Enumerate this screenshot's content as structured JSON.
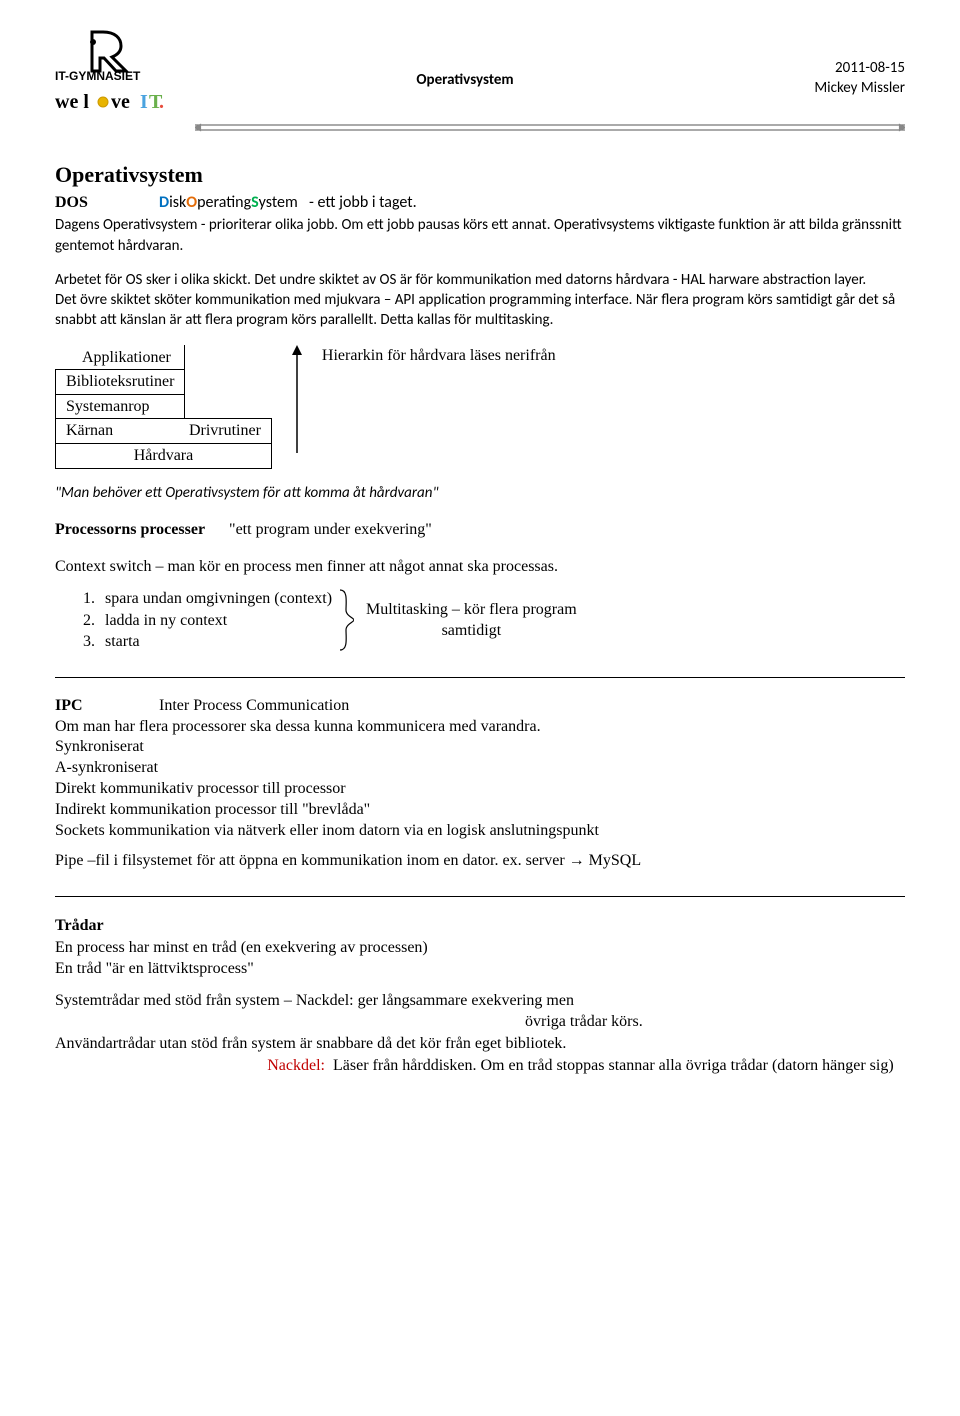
{
  "header": {
    "logo_alt": "IT-GYMNASIET — we love IT.",
    "center_title": "Operativsystem",
    "date": "2011-08-15",
    "author": "Mickey Missler"
  },
  "h1": "Operativsystem",
  "dos": {
    "term": "DOS",
    "expansion_pre_d": "D",
    "expansion_mid1": "isk",
    "expansion_pre_o": "O",
    "expansion_mid2": "perating",
    "expansion_pre_s": "S",
    "expansion_mid3": "ystem",
    "tail": "- ett jobb i taget."
  },
  "intro": {
    "p1": "Dagens Operativsystem - prioriterar olika jobb. Om ett jobb pausas körs ett annat. Operativsystems viktigaste funktion är att bilda gränssnitt gentemot hårdvaran.",
    "p2": "Arbetet för OS sker i olika skickt. Det undre skiktet av OS är för kommunikation med datorns hårdvara - HAL harware abstraction layer.",
    "p3": "Det övre skiktet sköter kommunikation med mjukvara – API application programming interface. När flera program körs samtidigt går det så snabbt att känslan är att flera program körs parallellt. Detta kallas för multitasking."
  },
  "hier": {
    "rows": [
      [
        "Applikationer"
      ],
      [
        "Biblioteksrutiner"
      ],
      [
        "Systemanrop"
      ],
      [
        "Kärnan",
        "Drivrutiner"
      ],
      [
        "Hårdvara"
      ]
    ],
    "caption": "Hierarkin för hårdvara läses nerifrån"
  },
  "quote": "\"Man behöver ett Operativsystem för att komma åt hårdvaran\"",
  "proc": {
    "heading": "Processorns processer",
    "sub": "\"ett program under exekvering\"",
    "context_switch": "Context switch – man kör en process men finner att något annat ska processas.",
    "list": [
      {
        "n": "1.",
        "t": "spara undan omgivningen (context)"
      },
      {
        "n": "2.",
        "t": "ladda in ny context"
      },
      {
        "n": "3.",
        "t": "starta"
      }
    ],
    "multitask_l1": "Multitasking – kör flera program",
    "multitask_l2": "samtidigt"
  },
  "ipc": {
    "term": "IPC",
    "exp": "Inter Process Communication",
    "lines": [
      "Om man har flera processorer ska dessa kunna kommunicera med varandra.",
      "Synkroniserat",
      "A-synkroniserat",
      "Direkt kommunikativ processor till processor",
      "Indirekt kommunikation processor till \"brevlåda\"",
      "Sockets kommunikation via nätverk eller inom datorn via en logisk anslutningspunkt"
    ],
    "pipe": "Pipe –fil i filsystemet för att öppna en kommunikation inom en dator. ex. server → MySQL"
  },
  "threads": {
    "heading": "Trådar",
    "l1": "En process har minst en tråd (en exekvering av processen)",
    "l2": "En tråd \"är en lättviktsprocess\"",
    "sys_a": "Systemtrådar med stöd från system – Nackdel: ger långsammare exekvering men",
    "sys_b": "övriga trådar körs.",
    "user": "Användartrådar utan stöd från system är snabbare då det kör från eget bibliotek.",
    "nackdel_label": "Nackdel:",
    "nackdel_body": "Läser från hårddisken. Om en tråd stoppas stannar alla övriga trådar (datorn hänger sig)"
  }
}
